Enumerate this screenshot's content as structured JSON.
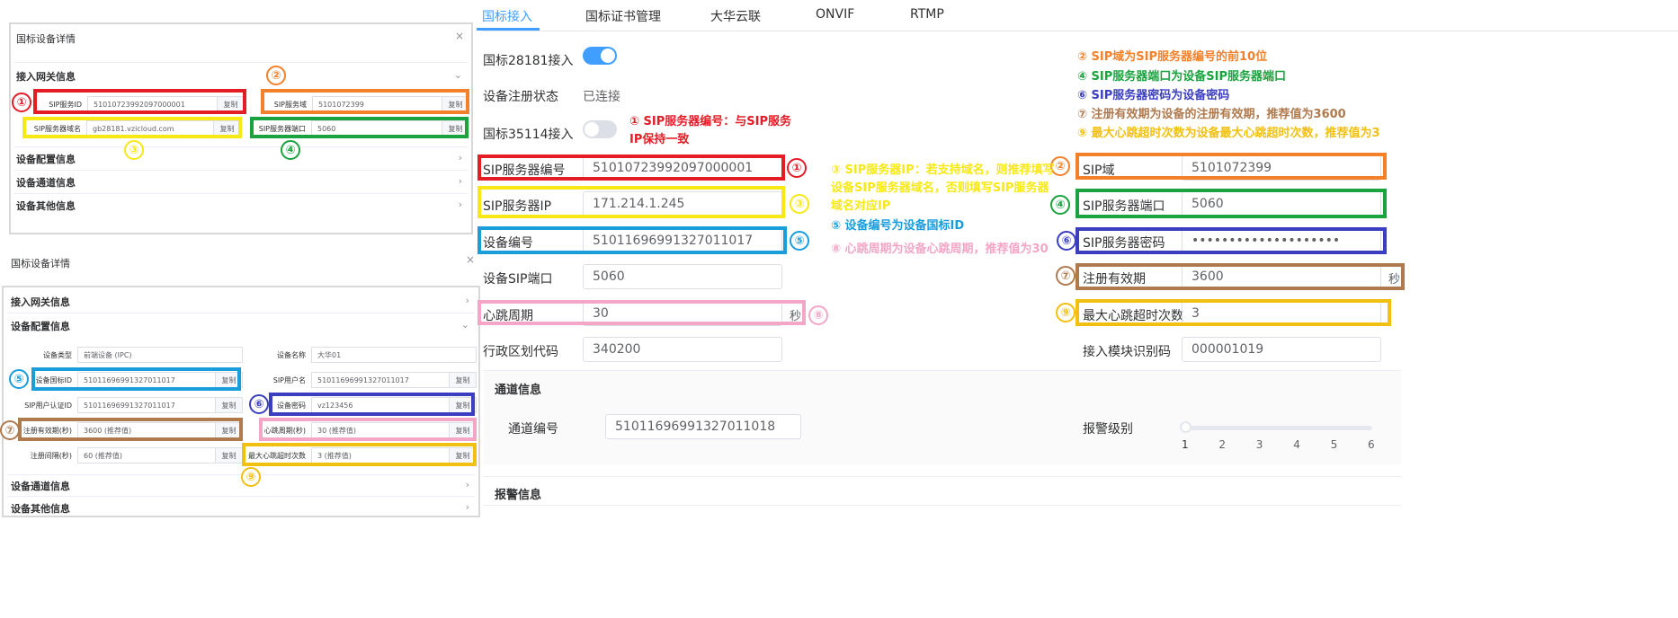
{
  "colors": {
    "red": "#e41c26",
    "orange": "#f4802a",
    "yellow": "#f7e816",
    "green": "#1aa33e",
    "blue": "#1a9ddb",
    "indigo": "#3b3fbf",
    "brown": "#b07a4f",
    "gold": "#f2c010",
    "pink": "#f3a6c6",
    "accent": "#409eff"
  },
  "top_panel": {
    "title": "国标设备详情",
    "close": "×",
    "section": "接入网关信息",
    "chev": "⌄",
    "fields": {
      "sip_id": {
        "label": "SIP服务ID",
        "value": "51010723992097000001",
        "copy": "复制"
      },
      "sip_domain": {
        "label": "SIP服务域",
        "value": "5101072399",
        "copy": "复制"
      },
      "sip_server_domain": {
        "label": "SIP服务器域名",
        "value": "gb28181.vzicloud.com",
        "copy": "复制"
      },
      "sip_port": {
        "label": "SIP服务器端口",
        "value": "5060",
        "copy": "复制"
      }
    },
    "collapsed": [
      {
        "label": "设备配置信息",
        "chev": "›"
      },
      {
        "label": "设备通道信息",
        "chev": "›"
      },
      {
        "label": "设备其他信息",
        "chev": "›"
      }
    ]
  },
  "bottom_panel": {
    "title": "国标设备详情",
    "close": "×",
    "sections": {
      "gateway": {
        "label": "接入网关信息",
        "chev": "›"
      },
      "config": {
        "label": "设备配置信息",
        "chev": "⌄"
      },
      "channel": {
        "label": "设备通道信息",
        "chev": "›"
      },
      "other": {
        "label": "设备其他信息",
        "chev": "›"
      }
    },
    "fields": {
      "device_type": {
        "label": "设备类型",
        "value": "前端设备 (IPC)"
      },
      "device_name": {
        "label": "设备名称",
        "value": "大华01"
      },
      "device_gb_id": {
        "label": "设备国标ID",
        "value": "51011696991327011017",
        "copy": "复制"
      },
      "sip_user": {
        "label": "SIP用户名",
        "value": "51011696991327011017",
        "copy": "复制"
      },
      "sip_auth_id": {
        "label": "SIP用户认证ID",
        "value": "51011696991327011017",
        "copy": "复制"
      },
      "device_pwd": {
        "label": "设备密码",
        "value": "vz123456",
        "copy": "复制"
      },
      "reg_validity": {
        "label": "注册有效期(秒)",
        "value": "3600 (推荐值)",
        "copy": "复制"
      },
      "heartbeat": {
        "label": "心跳周期(秒)",
        "value": "30 (推荐值)",
        "copy": "复制"
      },
      "reg_interval": {
        "label": "注册间隔(秒)",
        "value": "60 (推荐值)",
        "copy": "复制"
      },
      "max_heartbeat": {
        "label": "最大心跳超时次数",
        "value": "3 (推荐值)",
        "copy": "复制"
      }
    }
  },
  "numbers": {
    "n1": "①",
    "n2": "②",
    "n3": "③",
    "n4": "④",
    "n5": "⑤",
    "n6": "⑥",
    "n7": "⑦",
    "n8": "⑧",
    "n9": "⑨"
  },
  "tabs": [
    "国标接入",
    "国标证书管理",
    "大华云联",
    "ONVIF",
    "RTMP"
  ],
  "form": {
    "gb28181": "国标28181接入",
    "reg_status_label": "设备注册状态",
    "reg_status": "已连接",
    "gb35114": "国标35114接入",
    "sip_server_id": {
      "label": "SIP服务器编号",
      "value": "51010723992097000001"
    },
    "sip_server_ip": {
      "label": "SIP服务器IP",
      "value": "171.214.1.245"
    },
    "device_id": {
      "label": "设备编号",
      "value": "51011696991327011017"
    },
    "device_sip_port": {
      "label": "设备SIP端口",
      "value": "5060"
    },
    "heartbeat": {
      "label": "心跳周期",
      "value": "30",
      "unit": "秒"
    },
    "region_code": {
      "label": "行政区划代码",
      "value": "340200"
    },
    "sip_domain": {
      "label": "SIP域",
      "value": "5101072399"
    },
    "sip_server_port": {
      "label": "SIP服务器端口",
      "value": "5060"
    },
    "sip_server_pwd": {
      "label": "SIP服务器密码",
      "value": "••••••••••••••••••••"
    },
    "reg_validity": {
      "label": "注册有效期",
      "value": "3600",
      "unit": "秒"
    },
    "max_heartbeat": {
      "label": "最大心跳超时次数",
      "value": "3"
    },
    "module_code": {
      "label": "接入模块识别码",
      "value": "000001019"
    },
    "channel_section": "通道信息",
    "channel_no": {
      "label": "通道编号",
      "value": "51011696991327011018"
    },
    "alarm_level": {
      "label": "报警级别",
      "ticks": [
        "1",
        "2",
        "3",
        "4",
        "5",
        "6"
      ],
      "value": 1
    },
    "alarm_section": "报警信息"
  },
  "annotations": {
    "a1": "① SIP服务器编号：与SIP服务IP保持一致",
    "a3": "③ SIP服务器IP：若支持域名，则推荐填写设备SIP服务器域名，否则填写SIP服务器域名对应IP",
    "a5": "⑤ 设备编号为设备国标ID",
    "a8": "⑧ 心跳周期为设备心跳周期，推荐值为30",
    "a2": "② SIP域为SIP服务器编号的前10位",
    "a4": "④ SIP服务器端口为设备SIP服务器端口",
    "a6": "⑥ SIP服务器密码为设备密码",
    "a7": "⑦ 注册有效期为设备的注册有效期，推荐值为3600",
    "a9": "⑨ 最大心跳超时次数为设备最大心跳超时次数，推荐值为3"
  }
}
